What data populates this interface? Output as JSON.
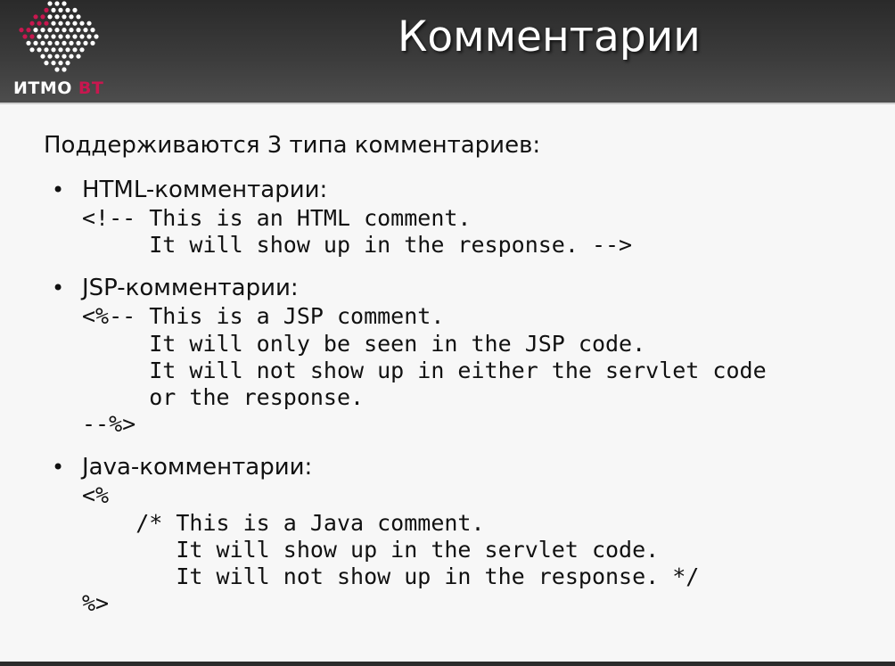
{
  "header": {
    "logo_text_primary": "ИТМО",
    "logo_text_secondary": "ВТ",
    "title": "Комментарии"
  },
  "intro": "Поддерживаются 3 типа комментариев:",
  "items": [
    {
      "title": "HTML-комментарии:",
      "code": "<!-- This is an HTML comment.\n     It will show up in the response. -->"
    },
    {
      "title": "JSP-комментарии:",
      "code": "<%-- This is a JSP comment.\n     It will only be seen in the JSP code.\n     It will not show up in either the servlet code\n     or the response.\n--%>"
    },
    {
      "title": "Java-комментарии:",
      "code": "<%\n    /* This is a Java comment.\n       It will show up in the servlet code.\n       It will not show up in the response. */\n%>"
    }
  ],
  "colors": {
    "header_dark": "#2a2a2a",
    "brand_accent": "#c8174f",
    "background": "#f7f7f7"
  }
}
